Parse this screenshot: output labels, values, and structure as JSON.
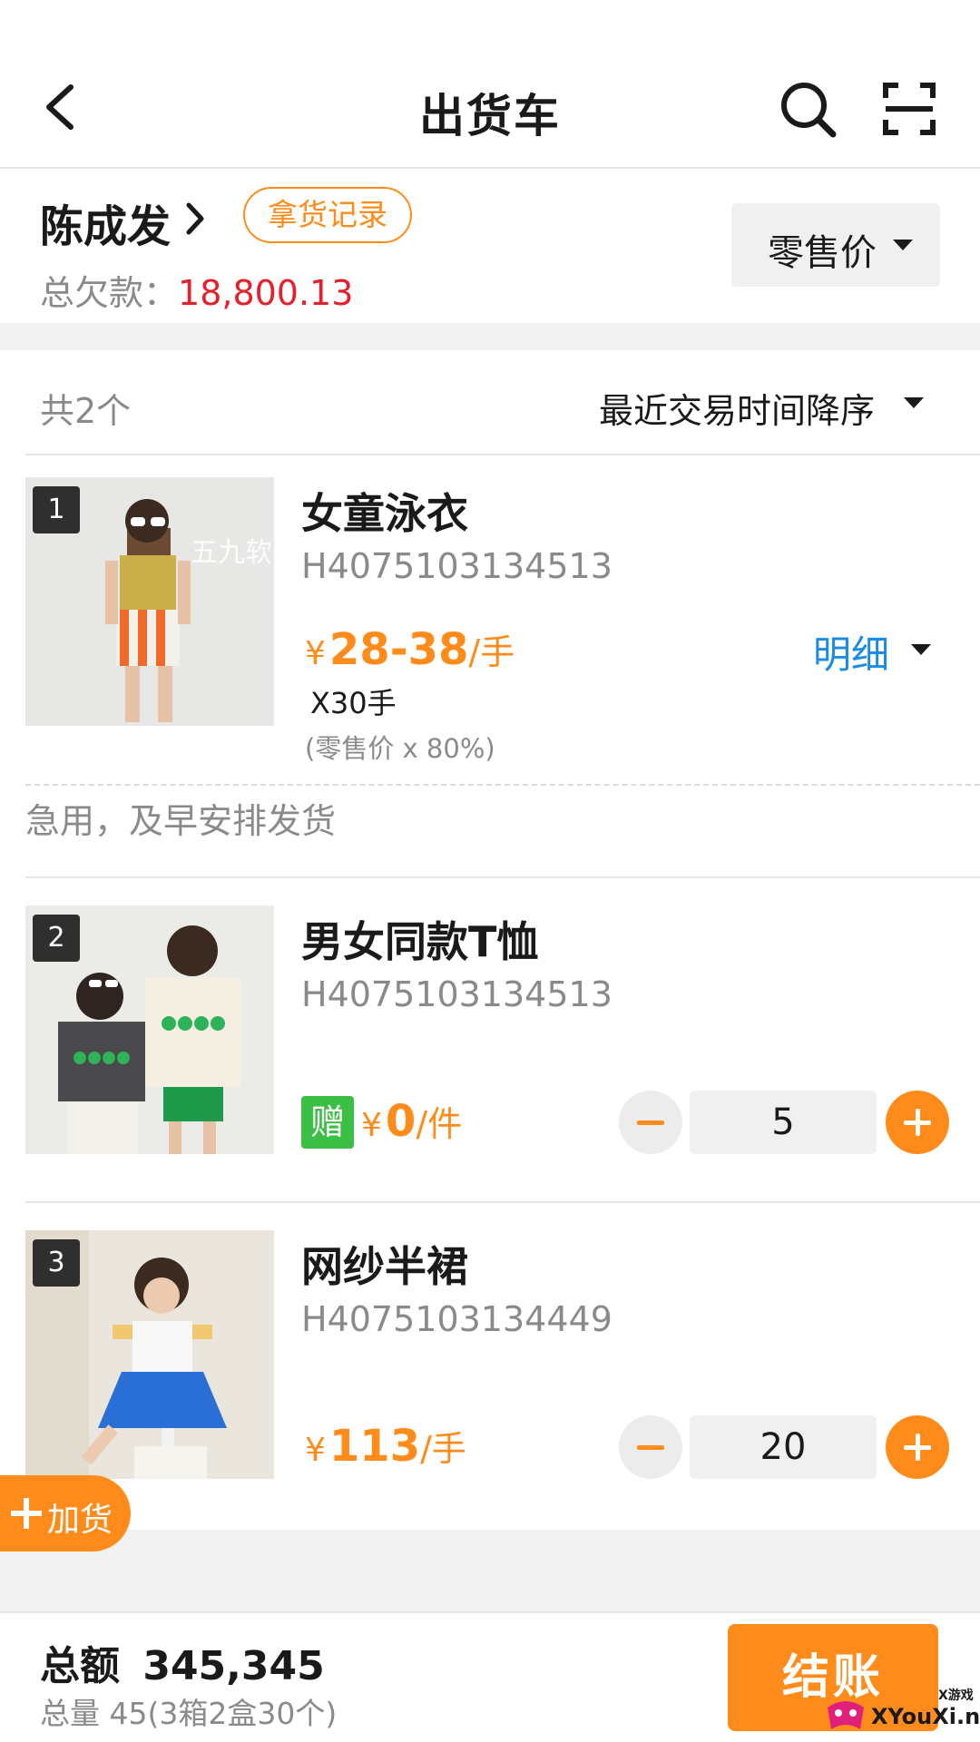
{
  "nav": {
    "title": "出货车"
  },
  "customer": {
    "name": "陈成发",
    "record_button": "拿货记录",
    "debt_label": "总欠款：",
    "debt_value": "18,800.13",
    "price_type": "零售价"
  },
  "list": {
    "count_label": "共2个",
    "sort_label": "最近交易时间降序"
  },
  "items": [
    {
      "index": "1",
      "name": "女童泳衣",
      "code": "H4075103134513",
      "price_symbol": "¥",
      "price_value": "28-38",
      "price_unit": "/手",
      "qty_text": "X30手",
      "discount": "(零售价 x 80%)",
      "detail_label": "明细",
      "thumb_watermark": "五九软"
    },
    {
      "index": "2",
      "name": "男女同款T恤",
      "code": "H4075103134513",
      "gift_badge": "赠",
      "price_symbol": "¥",
      "price_value": "0",
      "price_unit": "/件",
      "quantity": "5"
    },
    {
      "index": "3",
      "name": "网纱半裙",
      "code": "H4075103134449",
      "price_symbol": "¥",
      "price_value": "113",
      "price_unit": "/手",
      "quantity": "20"
    }
  ],
  "note": "急用，及早安排发货",
  "add_button": "加货",
  "footer": {
    "total_label": "总额",
    "total_value": "345,345",
    "total_qty": "总量 45(3箱2盒30个)",
    "checkout_label": "结账"
  },
  "watermark": {
    "text": "XYouXi.net",
    "subtext": "X游戏"
  },
  "colors": {
    "accent": "#ff8c1a",
    "debt": "#e5202b",
    "link": "#1a8ce5",
    "gift": "#3bbf45"
  }
}
